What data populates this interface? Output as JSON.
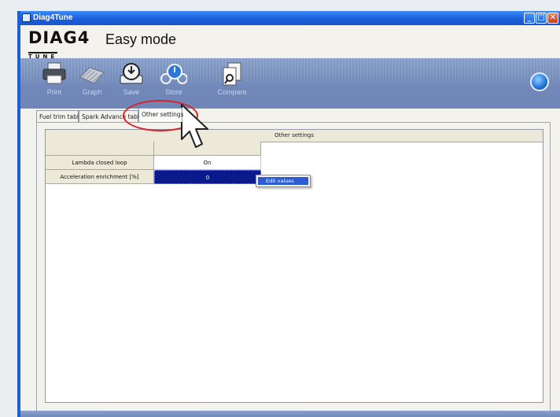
{
  "window": {
    "title": "Diag4Tune"
  },
  "brand": {
    "logo_main": "DIAG4",
    "logo_sub": "TUNE",
    "mode_title": "Easy mode"
  },
  "toolbar": {
    "items": [
      {
        "label": "Print",
        "icon": "printer-icon"
      },
      {
        "label": "Graph",
        "icon": "graph-icon"
      },
      {
        "label": "Save",
        "icon": "save-icon"
      },
      {
        "label": "Store",
        "icon": "store-icon"
      },
      {
        "label": "Compare",
        "icon": "compare-icon"
      }
    ],
    "globe_icon": "globe-icon"
  },
  "tabs": [
    {
      "label": "Fuel trim table",
      "active": false
    },
    {
      "label": "Spark Advance table",
      "active": false
    },
    {
      "label": "Other settings",
      "active": true
    }
  ],
  "grid": {
    "title": "Other settings",
    "rows": [
      {
        "label": "Lambda closed loop",
        "value": "On"
      },
      {
        "label": "Acceleration enrichment [%]",
        "value": "0"
      }
    ]
  },
  "context_menu": {
    "items": [
      "Edit values"
    ]
  },
  "colors": {
    "title_bar": "#1b5fdc",
    "toolbar": "#7087b8",
    "selection": "#0a1a8a",
    "highlight": "#d9232a",
    "menu_highlight": "#2c5ccf"
  }
}
